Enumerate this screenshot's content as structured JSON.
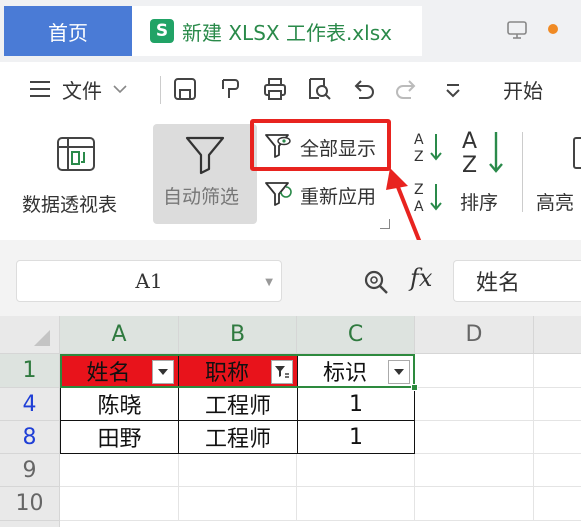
{
  "titlebar": {
    "home_tab": "首页",
    "doc_logo": "S",
    "doc_title": "新建 XLSX 工作表.xlsx"
  },
  "menubar": {
    "file_label": "文件",
    "start_label": "开始"
  },
  "ribbon": {
    "pivot_label": "数据透视表",
    "autofilter_label": "自动筛选",
    "show_all_label": "全部显示",
    "reapply_label": "重新应用",
    "sort_label": "排序",
    "highlight_label": "高亮"
  },
  "formula_bar": {
    "namebox_value": "A1",
    "fx_label": "fx",
    "formula_value": "姓名"
  },
  "grid": {
    "columns": [
      "A",
      "B",
      "C",
      "D"
    ],
    "rows": [
      {
        "row_num": "1",
        "cells": [
          "姓名",
          "职称",
          "标识",
          ""
        ]
      },
      {
        "row_num": "4",
        "cells": [
          "陈晓",
          "工程师",
          "1",
          ""
        ]
      },
      {
        "row_num": "8",
        "cells": [
          "田野",
          "工程师",
          "1",
          ""
        ]
      },
      {
        "row_num": "9",
        "cells": [
          "",
          "",
          "",
          ""
        ]
      },
      {
        "row_num": "10",
        "cells": [
          "",
          "",
          "",
          ""
        ]
      }
    ]
  },
  "colors": {
    "accent": "#4a7bd6",
    "highlight_red": "#e8231f",
    "header_red": "#e8131b",
    "selection_green": "#2d8a3e",
    "filtered_row_blue": "#1f3fd6"
  }
}
